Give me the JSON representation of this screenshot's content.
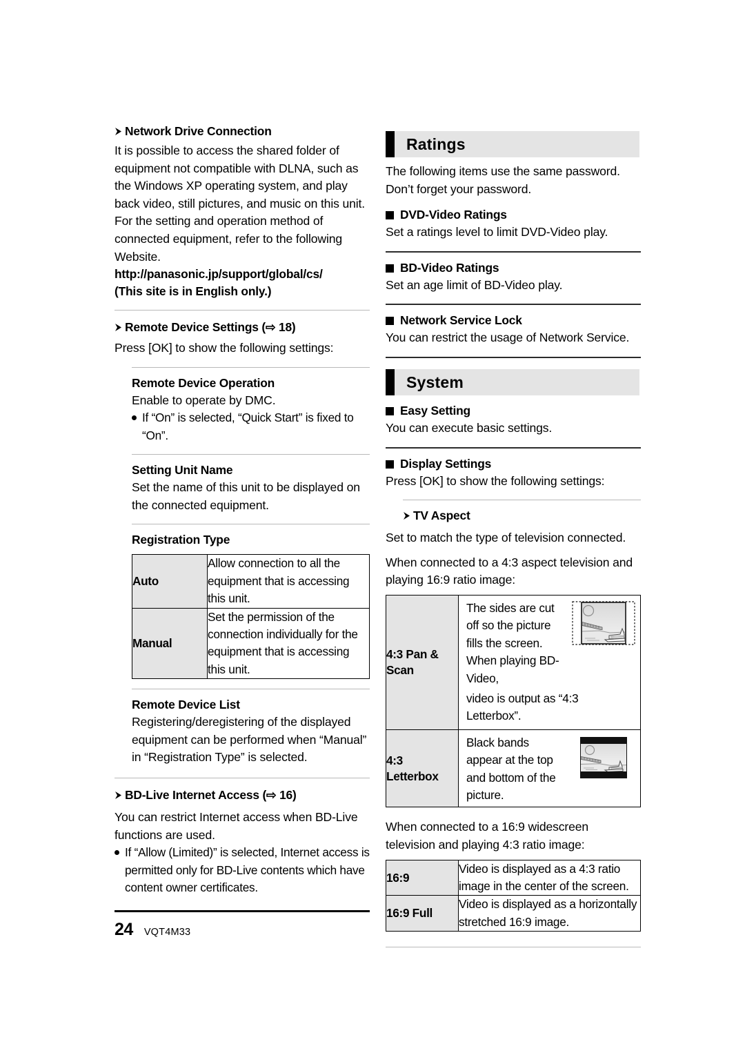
{
  "page": {
    "number": "24",
    "model_code": "VQT4M33"
  },
  "left_column": {
    "network_drive": {
      "heading": "Network Drive Connection",
      "body": "It is possible to access the shared folder of equipment not compatible with DLNA, such as the Windows XP operating system, and play back video, still pictures, and music on this unit. For the setting and operation method of connected equipment, refer to the following Website.",
      "url": "http://panasonic.jp/support/global/cs/",
      "note": "(This site is in English only.)"
    },
    "remote_device_settings": {
      "heading": "Remote Device Settings (",
      "page_ref": "18",
      "heading_close": ")",
      "intro": "Press [OK] to show the following settings:"
    },
    "remote_device_operation": {
      "heading": "Remote Device Operation",
      "body": "Enable to operate by DMC.",
      "bullet": "If “On” is selected, “Quick Start” is fixed to “On”."
    },
    "setting_unit_name": {
      "heading": "Setting Unit Name",
      "body": "Set the name of this unit to be displayed on the connected equipment."
    },
    "registration_type": {
      "heading": "Registration Type",
      "rows": [
        {
          "label": "Auto",
          "desc": "Allow connection to all the equipment that is accessing this unit."
        },
        {
          "label": "Manual",
          "desc": "Set the permission of the connection individually for the equipment that is accessing this unit."
        }
      ]
    },
    "remote_device_list": {
      "heading": "Remote Device List",
      "body": "Registering/deregistering of the displayed equipment can be performed when “Manual” in “Registration Type” is selected."
    },
    "bd_live": {
      "heading": "BD-Live Internet Access (",
      "page_ref": "16",
      "heading_close": ")",
      "body": "You can restrict Internet access when BD-Live functions are used.",
      "bullet": "If “Allow (Limited)” is selected, Internet access is permitted only for BD-Live contents which have content owner certificates."
    }
  },
  "right_column": {
    "ratings_section": {
      "title": "Ratings",
      "intro": "The following items use the same password. Don’t forget your password.",
      "items": [
        {
          "heading": "DVD-Video Ratings",
          "body": "Set a ratings level to limit DVD-Video play."
        },
        {
          "heading": "BD-Video Ratings",
          "body": "Set an age limit of BD-Video play."
        },
        {
          "heading": "Network Service Lock",
          "body": "You can restrict the usage of Network Service."
        }
      ]
    },
    "system_section": {
      "title": "System",
      "easy_setting": {
        "heading": "Easy Setting",
        "body": "You can execute basic settings."
      },
      "display_settings": {
        "heading": "Display Settings",
        "body": "Press [OK] to show the following settings:"
      },
      "tv_aspect": {
        "heading": "TV Aspect",
        "body": "Set to match the type of television connected.",
        "intro_43": "When connected to a 4:3 aspect television and playing 16:9 ratio image:",
        "table_43": [
          {
            "label": "4:3 Pan & Scan",
            "desc_top": "The sides are cut off so the picture fills the screen. When playing BD-Video,",
            "desc_bottom": "video is output as “4:3 Letterbox”.",
            "figure": "pan-scan-illustration"
          },
          {
            "label": "4:3 Letterbox",
            "desc_top": "Black bands appear at the top and bottom of the picture.",
            "desc_bottom": "",
            "figure": "letterbox-illustration"
          }
        ],
        "intro_169": "When connected to a 16:9 widescreen television and playing 4:3 ratio image:",
        "table_169": [
          {
            "label": "16:9",
            "desc": "Video is displayed as a 4:3 ratio image in the center of the screen."
          },
          {
            "label": "16:9 Full",
            "desc": "Video is displayed as a horizontally stretched 16:9 image."
          }
        ]
      }
    }
  }
}
